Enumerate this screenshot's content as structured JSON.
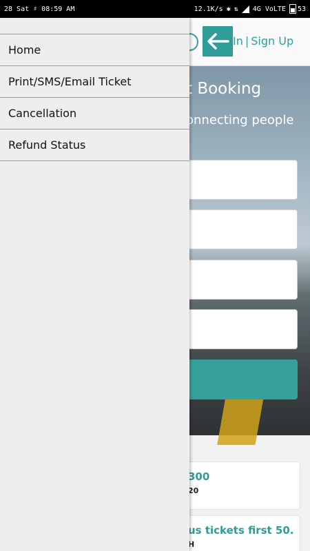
{
  "status_bar": {
    "left_text": "28 Sat ♯ 08:59 AM",
    "speed": "12.1K/s",
    "network": "4G VoLTE",
    "battery": "53"
  },
  "app": {
    "auth_login_fragment": "In",
    "auth_separator": "|",
    "auth_signup": "Sign Up"
  },
  "hero": {
    "title_fragment": "t Booking",
    "subtitle_fragment": "onnecting people"
  },
  "cards": [
    {
      "title": "300",
      "subtitle": "20"
    },
    {
      "title": "us tickets first 50...",
      "subtitle": "H"
    }
  ],
  "drawer": {
    "items": [
      {
        "label": "Home"
      },
      {
        "label": "Print/SMS/Email Ticket"
      },
      {
        "label": "Cancellation"
      },
      {
        "label": "Refund Status"
      }
    ]
  },
  "colors": {
    "accent": "#2f9c98",
    "status_bar": "#000000",
    "drawer_bg": "#eeeeee"
  }
}
